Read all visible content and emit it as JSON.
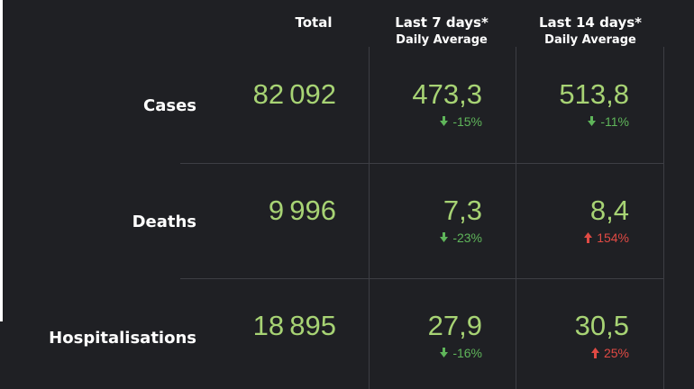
{
  "colors": {
    "background": "#1f2024",
    "value_green": "#a7d374",
    "delta_down": "#5fb55a",
    "delta_up": "#e04a44",
    "grid": "#3d3e44"
  },
  "header": {
    "total": "Total",
    "last7": "Last 7 days*",
    "last7_sub": "Daily Average",
    "last14": "Last 14 days*",
    "last14_sub": "Daily Average"
  },
  "rows": [
    {
      "label": "Cases",
      "total": "82 092",
      "avg7": "473,3",
      "avg7_delta": "-15%",
      "avg7_direction": "down",
      "avg14": "513,8",
      "avg14_delta": "-11%",
      "avg14_direction": "down"
    },
    {
      "label": "Deaths",
      "total": "9 996",
      "avg7": "7,3",
      "avg7_delta": "-23%",
      "avg7_direction": "down",
      "avg14": "8,4",
      "avg14_delta": "154%",
      "avg14_direction": "up"
    },
    {
      "label": "Hospitalisations",
      "total": "18 895",
      "avg7": "27,9",
      "avg7_delta": "-16%",
      "avg7_direction": "down",
      "avg14": "30,5",
      "avg14_delta": "25%",
      "avg14_direction": "up"
    }
  ]
}
